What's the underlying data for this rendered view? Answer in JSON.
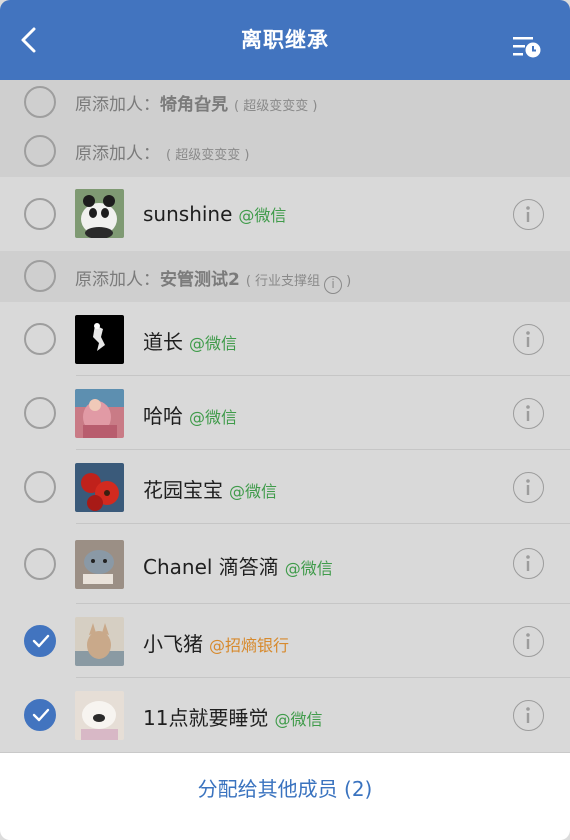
{
  "header": {
    "title": "离职继承",
    "back_icon": "chevron-left-icon",
    "history_icon": "list-clock-icon"
  },
  "groups": [
    {
      "prefix": "原添加人：",
      "name": "犄角旮旯",
      "sub": "( 超级变变变 )"
    },
    {
      "prefix": "原添加人：",
      "name": "",
      "sub": "( 超级变变变 )"
    },
    {
      "prefix": "原添加人：",
      "name": "安管测试2",
      "sub_before": "( 行业支撑组",
      "sub_after": ")"
    }
  ],
  "contacts": [
    {
      "name": "sunshine",
      "tag": "@微信",
      "tag_color": "#3f9b4a",
      "checked": false
    },
    {
      "name": "道长",
      "tag": "@微信",
      "tag_color": "#3f9b4a",
      "checked": false
    },
    {
      "name": "哈哈",
      "tag": "@微信",
      "tag_color": "#3f9b4a",
      "checked": false
    },
    {
      "name": "花园宝宝",
      "tag": "@微信",
      "tag_color": "#3f9b4a",
      "checked": false
    },
    {
      "name": "Chanel 滴答滴",
      "tag": "@微信",
      "tag_color": "#3f9b4a",
      "checked": false
    },
    {
      "name": "小飞猪",
      "tag": "@招熵银行",
      "tag_color": "#d78a2d",
      "checked": true
    },
    {
      "name": "11点就要睡觉",
      "tag": "@微信",
      "tag_color": "#3f9b4a",
      "checked": true
    }
  ],
  "footer": {
    "assign_label": "分配给其他成员 (2)"
  },
  "colors": {
    "accent": "#4274bf",
    "wechat_green": "#3f9b4a",
    "org_orange": "#d78a2d"
  }
}
